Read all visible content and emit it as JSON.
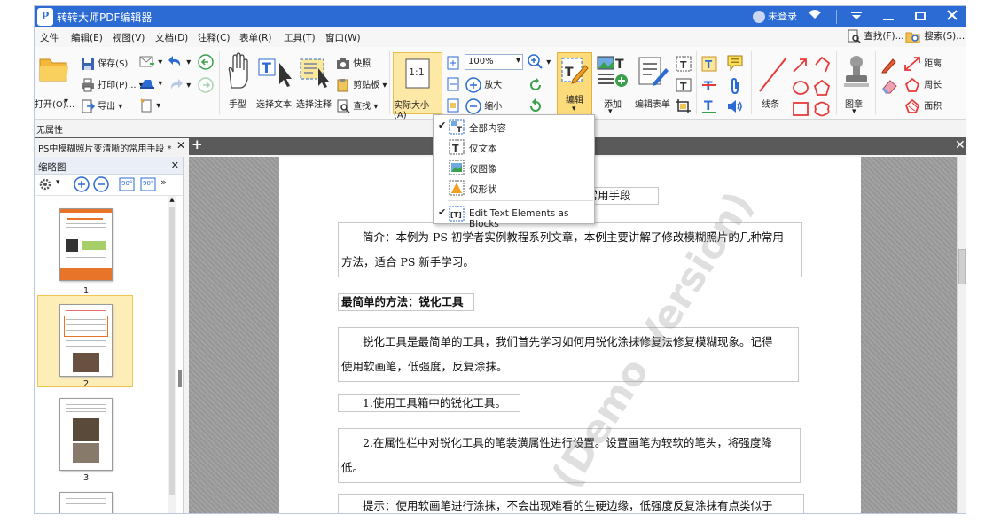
{
  "app": {
    "title": "转转大师PDF编辑器",
    "user": "未登录",
    "logo_letter": "P",
    "colors": {
      "titlebar": "#2b6bd3",
      "highlight": "#fcdb7a",
      "accent_red": "#e83a3a"
    }
  },
  "menu": [
    "文件",
    "编辑(E)",
    "视图(V)",
    "文档(D)",
    "注释(C)",
    "表单(R)",
    "工具(T)",
    "窗口(W)"
  ],
  "menu_right": {
    "find": "查找(F)...",
    "search": "搜索(S)..."
  },
  "ribbon": {
    "open": "打开(O)...",
    "save": "保存(S)",
    "print": "打印(P)...",
    "export": "导出",
    "hand": "手型",
    "select_text": "选择文本",
    "select_annot": "选择注释",
    "snapshot": "快照",
    "clipboard": "剪贴板",
    "find": "查找",
    "actual_size": "实际大小(A)",
    "actual_size_icon": "1:1",
    "zoom_value": "100%",
    "zoom_in": "放大",
    "zoom_out": "缩小",
    "edit": "编辑",
    "add": "添加",
    "edit_form": "编辑表单",
    "line": "线条",
    "stamp": "图章",
    "distance": "距离",
    "perimeter": "周长",
    "area": "面积"
  },
  "status": {
    "properties": "无属性"
  },
  "tab": {
    "name": "PS中模糊照片变清晰的常用手段 *"
  },
  "thumbs": {
    "title": "缩略图",
    "pages": [
      "1",
      "2",
      "3"
    ],
    "rotate_left": "90°",
    "rotate_right": "90°"
  },
  "dropdown": {
    "items": [
      {
        "label": "全部内容",
        "checked": true
      },
      {
        "label": "仅文本",
        "checked": false
      },
      {
        "label": "仅图像",
        "checked": false
      },
      {
        "label": "仅形状",
        "checked": false
      },
      {
        "label": "Edit Text Elements as Blocks",
        "checked": true
      }
    ]
  },
  "document": {
    "title_fragment": "的常用手段",
    "intro_1": "简介：本例为 PS 初学者实例教程系列文章，本例主要讲解了修改模糊照片的几种常用",
    "intro_2": "方法，适合 PS 新手学习。",
    "heading": "最简单的方法：锐化工具",
    "para1_1": "锐化工具是最简单的工具，我们首先学习如何用锐化涂抹修复法修复模糊现象。记得",
    "para1_2": "使用软画笔，低强度，反复涂抹。",
    "step1": "1.使用工具箱中的锐化工具。",
    "step2_1": "2.在属性栏中对锐化工具的笔装潢属性进行设置。设置画笔为较软的笔头，将强度降",
    "step2_2": "低。",
    "tip": "提示：使用软画笔进行涂抹，不会出现难看的生硬边缘，低强度反复涂抹有点类似于",
    "watermark": "(Demo Version)"
  }
}
